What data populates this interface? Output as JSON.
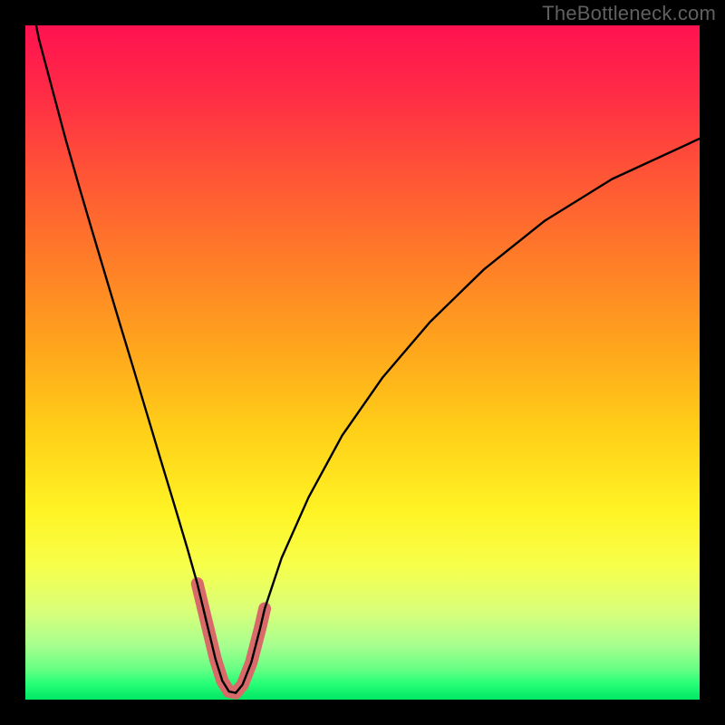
{
  "watermark": "TheBottleneck.com",
  "gradient": {
    "stops": [
      {
        "offset": 0.0,
        "color": "#ff1250"
      },
      {
        "offset": 0.1,
        "color": "#ff2b46"
      },
      {
        "offset": 0.22,
        "color": "#ff5436"
      },
      {
        "offset": 0.35,
        "color": "#ff7d28"
      },
      {
        "offset": 0.48,
        "color": "#ffa61c"
      },
      {
        "offset": 0.6,
        "color": "#ffcf18"
      },
      {
        "offset": 0.72,
        "color": "#fff324"
      },
      {
        "offset": 0.8,
        "color": "#f7ff4a"
      },
      {
        "offset": 0.87,
        "color": "#d8ff7a"
      },
      {
        "offset": 0.92,
        "color": "#a6ff8e"
      },
      {
        "offset": 0.955,
        "color": "#66ff84"
      },
      {
        "offset": 0.975,
        "color": "#2aff77"
      },
      {
        "offset": 1.0,
        "color": "#00e765"
      }
    ]
  },
  "chart_data": {
    "type": "line",
    "title": "",
    "xlabel": "",
    "ylabel": "",
    "xlim": [
      0,
      1
    ],
    "ylim": [
      0,
      1
    ],
    "legend": false,
    "grid": false,
    "series": [
      {
        "name": "bottleneck-curve",
        "color": "#000000",
        "width": 2.4,
        "highlight": {
          "x_range": [
            0.255,
            0.355
          ],
          "color": "#d96a6a",
          "width": 14
        },
        "points": [
          {
            "x": 0.0,
            "y": 1.08
          },
          {
            "x": 0.02,
            "y": 0.98
          },
          {
            "x": 0.04,
            "y": 0.905
          },
          {
            "x": 0.06,
            "y": 0.83
          },
          {
            "x": 0.08,
            "y": 0.76
          },
          {
            "x": 0.1,
            "y": 0.692
          },
          {
            "x": 0.12,
            "y": 0.625
          },
          {
            "x": 0.14,
            "y": 0.558
          },
          {
            "x": 0.16,
            "y": 0.492
          },
          {
            "x": 0.18,
            "y": 0.425
          },
          {
            "x": 0.2,
            "y": 0.358
          },
          {
            "x": 0.22,
            "y": 0.292
          },
          {
            "x": 0.24,
            "y": 0.225
          },
          {
            "x": 0.255,
            "y": 0.172
          },
          {
            "x": 0.268,
            "y": 0.118
          },
          {
            "x": 0.282,
            "y": 0.06
          },
          {
            "x": 0.292,
            "y": 0.028
          },
          {
            "x": 0.302,
            "y": 0.012
          },
          {
            "x": 0.312,
            "y": 0.01
          },
          {
            "x": 0.322,
            "y": 0.022
          },
          {
            "x": 0.335,
            "y": 0.055
          },
          {
            "x": 0.348,
            "y": 0.105
          },
          {
            "x": 0.355,
            "y": 0.135
          },
          {
            "x": 0.38,
            "y": 0.21
          },
          {
            "x": 0.42,
            "y": 0.3
          },
          {
            "x": 0.47,
            "y": 0.392
          },
          {
            "x": 0.53,
            "y": 0.478
          },
          {
            "x": 0.6,
            "y": 0.56
          },
          {
            "x": 0.68,
            "y": 0.638
          },
          {
            "x": 0.77,
            "y": 0.71
          },
          {
            "x": 0.87,
            "y": 0.772
          },
          {
            "x": 1.0,
            "y": 0.832
          }
        ]
      }
    ]
  }
}
